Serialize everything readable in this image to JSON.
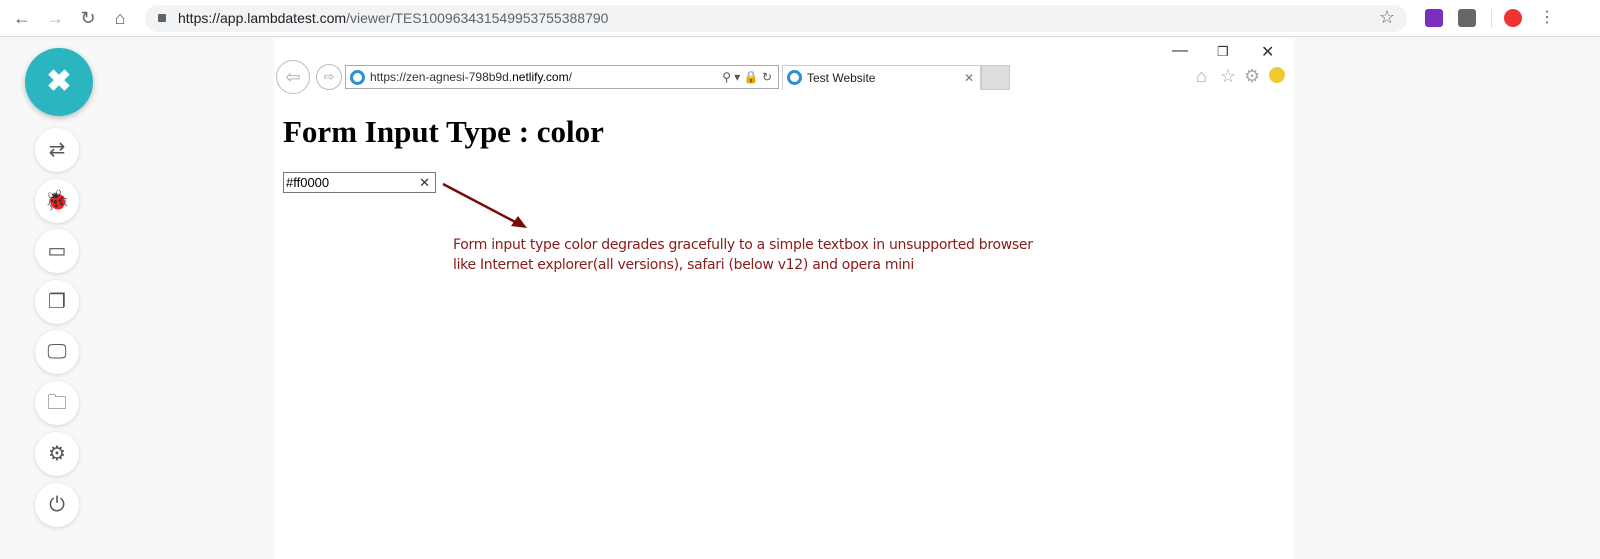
{
  "browser": {
    "url_host": "https://app.lambdatest.com",
    "url_path": "/viewer/TES100963431549953755388790"
  },
  "sidebar": {
    "close": "✖",
    "items": [
      {
        "name": "switch",
        "glyph": "⇄"
      },
      {
        "name": "bug",
        "glyph": "🐞"
      },
      {
        "name": "video",
        "glyph": "▭"
      },
      {
        "name": "screenshots",
        "glyph": "❐"
      },
      {
        "name": "resolution",
        "glyph": "🖵"
      },
      {
        "name": "folder",
        "glyph": "🗀"
      },
      {
        "name": "settings",
        "glyph": "⚙"
      },
      {
        "name": "power",
        "glyph": "⏻"
      }
    ]
  },
  "ie": {
    "url_prefix": "https://zen-agnesi-798b9d.",
    "url_domain": "netlify.com",
    "url_suffix": "/",
    "tab_title": "Test Website"
  },
  "page": {
    "heading": "Form Input Type : color",
    "input_value": "#ff0000",
    "note_line1": "Form input type color degrades gracefully to a simple textbox in unsupported browsers",
    "note_line2": "like Internet explorer(all versions), safari (below v12) and opera mini"
  },
  "colors": {
    "accent": "#2bb5c0",
    "note": "#8b1a1a"
  }
}
